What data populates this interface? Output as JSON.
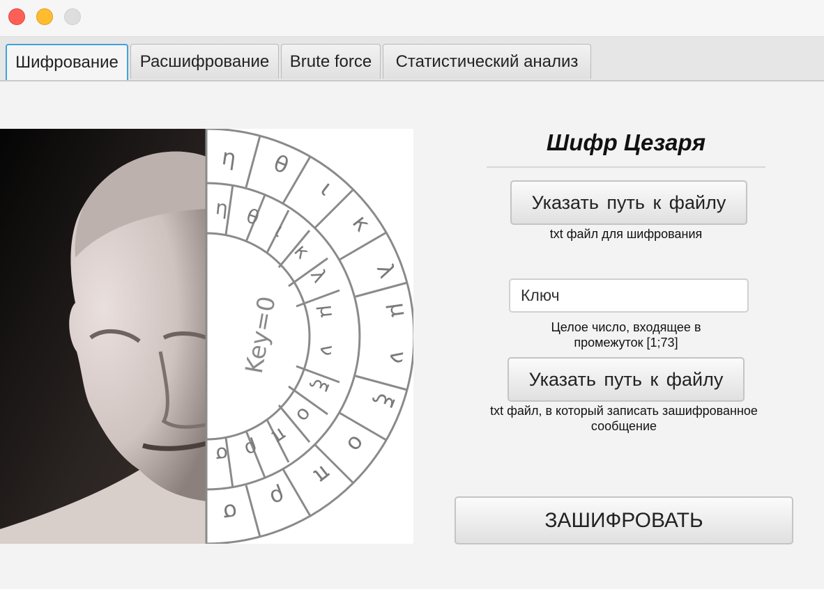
{
  "window": {
    "controls": {
      "close": "#fe5f57",
      "minimize": "#febc2e",
      "zoom": "#dedede"
    }
  },
  "tabs": [
    {
      "label": "Шифрование",
      "active": true
    },
    {
      "label": "Расшифрование",
      "active": false
    },
    {
      "label": "Brute force",
      "active": false
    },
    {
      "label": "Статистический анализ",
      "active": false
    }
  ],
  "illustration": {
    "wheel_key_label": "Key=0",
    "outer_ring_letters": [
      "η",
      "θ",
      "ι",
      "κ",
      "λ",
      "μ",
      "ν",
      "ξ",
      "ο",
      "π",
      "ρ",
      "σ"
    ],
    "inner_ring_letters": [
      "η",
      "θ",
      "ι",
      "κ",
      "λ",
      "μ",
      "ν",
      "ξ",
      "ο",
      "π",
      "ρ",
      "σ"
    ]
  },
  "form": {
    "title": "Шифр Цезаря",
    "input_file_button": "Указать путь к файлу",
    "input_file_hint": "txt файл для шифрования",
    "key_placeholder": "Ключ",
    "key_hint_line1": "Целое число, входящее в",
    "key_hint_line2": "промежуток [1;73]",
    "output_file_button": "Указать путь к файлу",
    "output_file_hint_line1": "txt файл, в который записать зашифрованное",
    "output_file_hint_line2": "сообщение",
    "encrypt_button": "ЗАШИФРОВАТЬ"
  },
  "colors": {
    "accent": "#3ea3d9"
  }
}
